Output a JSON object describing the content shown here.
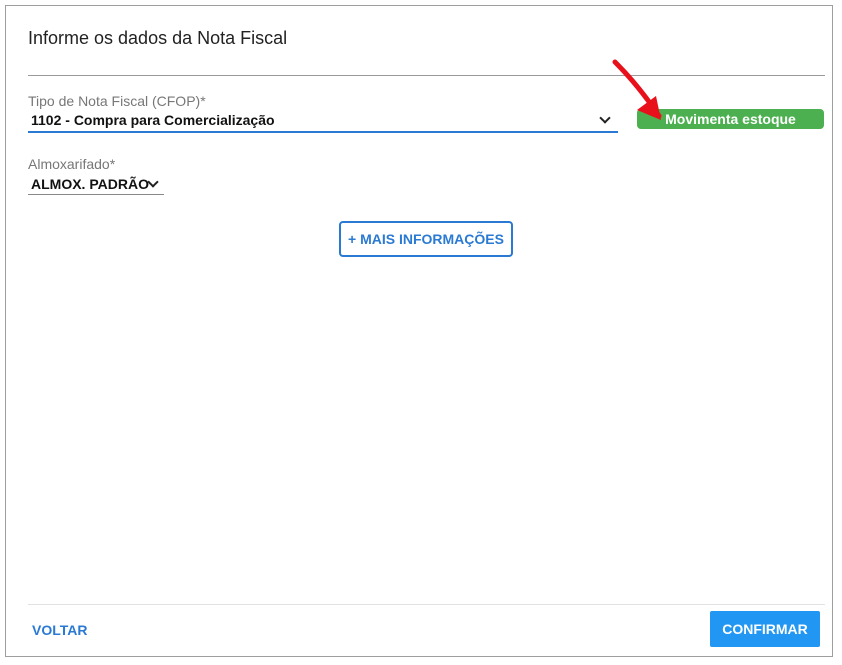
{
  "dialog": {
    "title": "Informe os dados da Nota Fiscal"
  },
  "cfop": {
    "label": "Tipo de Nota Fiscal (CFOP)*",
    "value": "1102 - Compra para Comercialização",
    "badge": "Movimenta estoque",
    "badge_color": "#4caf50"
  },
  "almoxarifado": {
    "label": "Almoxarifado*",
    "value": "ALMOX. PADRÃO"
  },
  "more_info_button": "+ MAIS INFORMAÇÕES",
  "footer": {
    "back_label": "VOLTAR",
    "confirm_label": "CONFIRMAR"
  },
  "colors": {
    "accent": "#2a7ad3",
    "confirm": "#2196f3",
    "annotation_arrow": "#e8101a"
  },
  "icons": {
    "select_chevron": "chevron-down-icon",
    "annotation": "red-arrow-icon"
  }
}
